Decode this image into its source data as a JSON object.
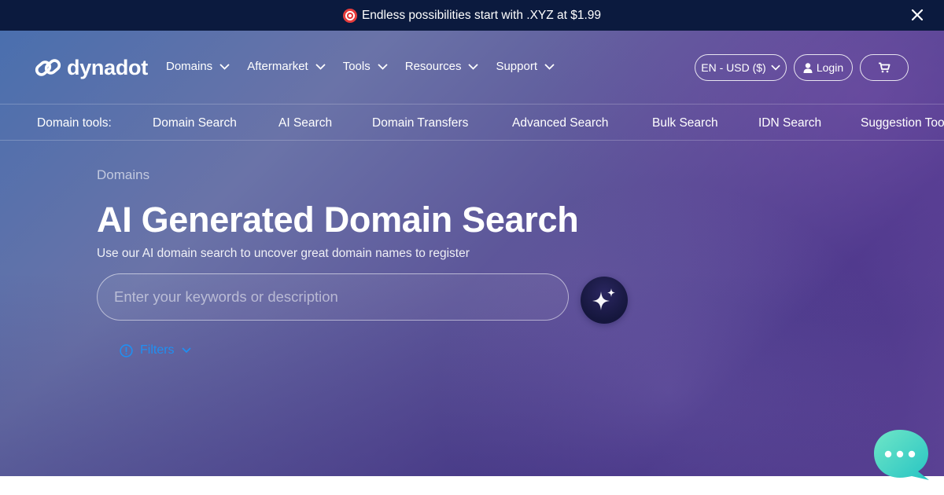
{
  "promo": {
    "text": "Endless possibilities start with .XYZ at $1.99"
  },
  "logo": {
    "text": "dynadot"
  },
  "nav": {
    "items": [
      {
        "label": "Domains"
      },
      {
        "label": "Aftermarket"
      },
      {
        "label": "Tools"
      },
      {
        "label": "Resources"
      },
      {
        "label": "Support"
      }
    ],
    "language": "EN - USD ($)",
    "login": "Login"
  },
  "tools_bar": {
    "label": "Domain tools:",
    "items": [
      "Domain Search",
      "AI Search",
      "Domain Transfers",
      "Advanced Search",
      "Bulk Search",
      "IDN Search",
      "Suggestion Tool"
    ]
  },
  "hero": {
    "breadcrumb": "Domains",
    "title": "AI Generated Domain Search",
    "subtitle": "Use our AI domain search to uncover great domain names to register",
    "search_placeholder": "Enter your keywords or description",
    "filters_label": "Filters"
  },
  "colors": {
    "promo_bg": "#0b1a3e",
    "accent_link": "#1f9bff",
    "chat_bubble": "#3fd6c3"
  },
  "icons": [
    "target-icon",
    "close-icon",
    "logo-link-icon",
    "chevron-down-icon",
    "user-icon",
    "cart-icon",
    "sparkle-icon",
    "info-icon",
    "chat-icon"
  ]
}
